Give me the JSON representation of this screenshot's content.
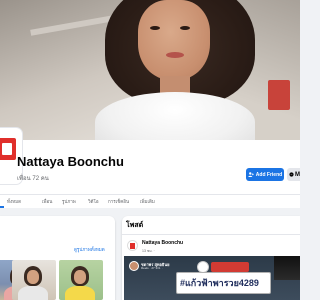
{
  "profile": {
    "name": "Nattaya Boonchu",
    "friend_count": "เพื่อน 72 คน",
    "add_friend_label": "Add Friend",
    "message_label": "M"
  },
  "tabs": [
    {
      "label": "ทั้งหมด"
    },
    {
      "label": "เพื่อน"
    },
    {
      "label": "รูปภาพ"
    },
    {
      "label": "วิดีโอ"
    },
    {
      "label": "การเช็คอิน"
    },
    {
      "label": "เพิ่มเติม"
    }
  ],
  "photos_card": {
    "see_all_label": "ดูรูปภาพทั้งหมด"
  },
  "posts": {
    "title": "โพสต์",
    "author": "Nattaya Boonchu",
    "time": "13 ชม. ·",
    "shared": {
      "author": "ชดาพร สุทอธินย",
      "meta": "Reels · 27 มิ.ย. ·",
      "plate_text": "#แก้วฟ้าพารวย4289"
    }
  },
  "colors": {
    "accent": "#1b74e4",
    "brand_red": "#e02f2b",
    "page_bg": "#f0f2f5"
  }
}
